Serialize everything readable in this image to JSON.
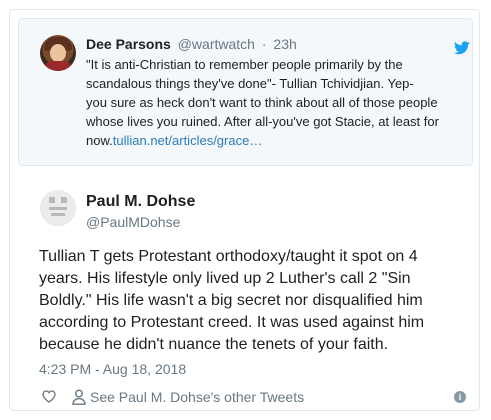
{
  "quoted_tweet": {
    "author_name": "Dee Parsons",
    "author_handle": "@wartwatch",
    "separator": "·",
    "time": "23h",
    "text_line1": "\"It is anti-Christian to remember people primarily by the",
    "text_line2": "scandalous things they've done\"- Tullian Tchividjian.  Yep-",
    "text_line3": "you sure as heck don't want to think about all of those people",
    "text_line4": "whose lives you ruined. After all-you've got Stacie, at least for",
    "text_line5_prefix": "now.",
    "link_text": "tullian.net/articles/grace…",
    "link_color": "#2b7bb9"
  },
  "tweet": {
    "author_name": "Paul M. Dohse",
    "author_handle": "@PaulMDohse",
    "text_line1": "Tullian T gets Protestant orthodoxy/taught it spot on 4",
    "text_line2": "years. His lifestyle only lived up 2 Luther's call 2 \"Sin",
    "text_line3": "Boldly.\" His life wasn't a big secret nor disqualified him",
    "text_line4": "according to Protestant creed. It was used against him",
    "text_line5": "because he didn't nuance the tenets of your faith.",
    "timestamp": "4:23 PM - Aug 18, 2018"
  },
  "actions": {
    "other_tweets_label": "See Paul M. Dohse's other Tweets",
    "info_label": "i",
    "heart_icon": "heart-icon",
    "person_icon": "person-icon"
  },
  "colors": {
    "twitter_blue": "#1da1f2",
    "secondary_text": "#697882",
    "border": "#e1e8ed"
  }
}
